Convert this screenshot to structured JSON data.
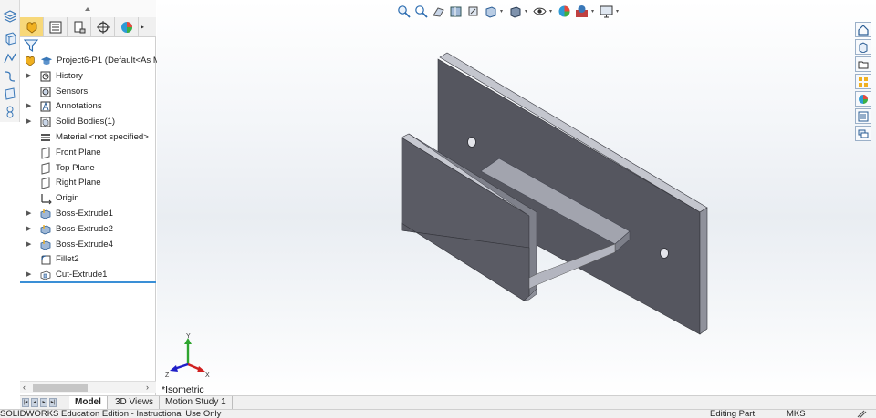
{
  "feature_tree": {
    "root": {
      "label": "Project6-P1  (Default<As M"
    },
    "items": [
      {
        "label": "History",
        "icon": "history-icon",
        "expandable": true
      },
      {
        "label": "Sensors",
        "icon": "sensor-icon",
        "expandable": false
      },
      {
        "label": "Annotations",
        "icon": "annotation-icon",
        "expandable": true
      },
      {
        "label": "Solid Bodies(1)",
        "icon": "solid-bodies-icon",
        "expandable": true
      },
      {
        "label": "Material <not specified>",
        "icon": "material-icon",
        "expandable": false
      },
      {
        "label": "Front Plane",
        "icon": "plane-icon",
        "expandable": false
      },
      {
        "label": "Top Plane",
        "icon": "plane-icon",
        "expandable": false
      },
      {
        "label": "Right Plane",
        "icon": "plane-icon",
        "expandable": false
      },
      {
        "label": "Origin",
        "icon": "origin-icon",
        "expandable": false
      },
      {
        "label": "Boss-Extrude1",
        "icon": "extrude-icon",
        "expandable": true
      },
      {
        "label": "Boss-Extrude2",
        "icon": "extrude-icon",
        "expandable": true
      },
      {
        "label": "Boss-Extrude4",
        "icon": "extrude-icon",
        "expandable": true
      },
      {
        "label": "Fillet2",
        "icon": "fillet-icon",
        "expandable": false
      },
      {
        "label": "Cut-Extrude1",
        "icon": "cut-extrude-icon",
        "expandable": true
      }
    ]
  },
  "viewport": {
    "view_name": "*Isometric"
  },
  "bottom_tabs": [
    {
      "label": "Model",
      "active": true
    },
    {
      "label": "3D Views",
      "active": false
    },
    {
      "label": "Motion Study 1",
      "active": false
    }
  ],
  "status_bar": {
    "left": "SOLIDWORKS Education Edition - Instructional Use Only",
    "mode": "Editing Part",
    "units": "MKS"
  },
  "colors": {
    "model_face_dark": "#55565f",
    "model_face_light": "#a2a4ae",
    "accent_blue": "#3a8fd6",
    "active_tab": "#f7d87a"
  }
}
